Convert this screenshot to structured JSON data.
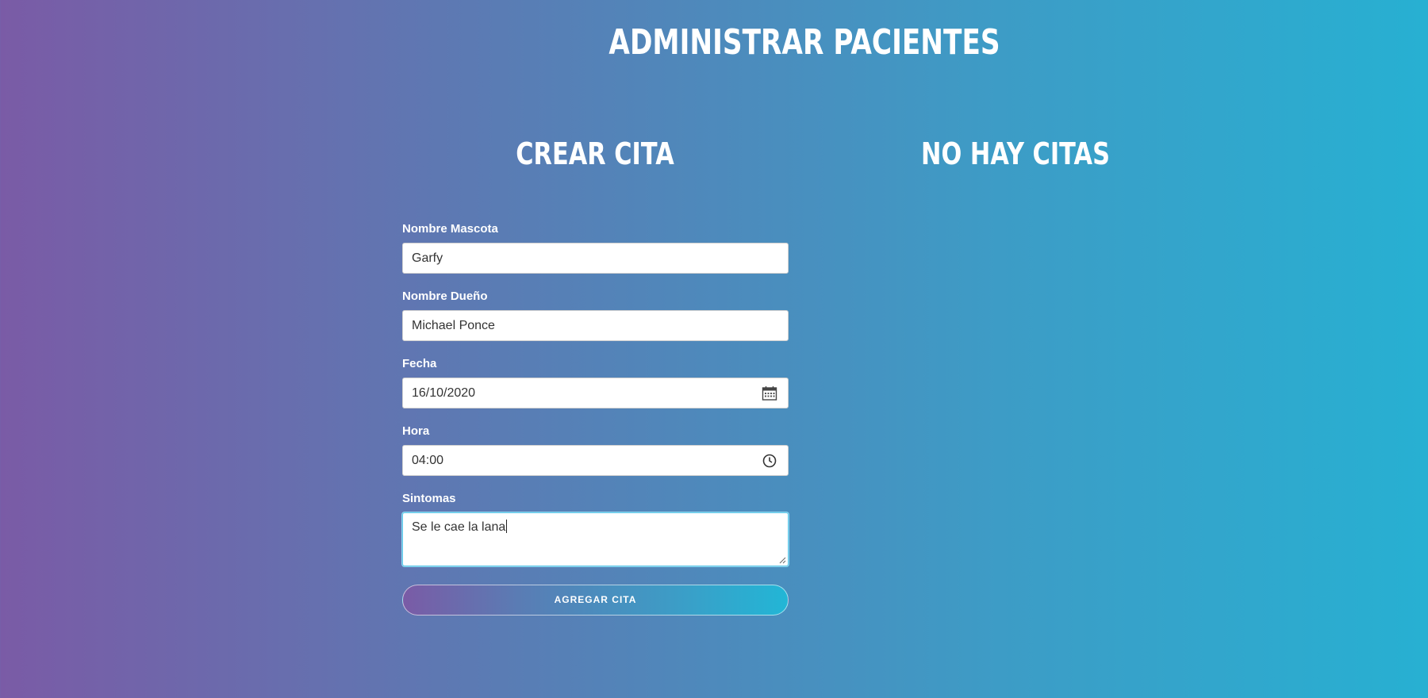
{
  "header": {
    "title": "Administrar Pacientes"
  },
  "sections": {
    "create_title": "Crear Cita",
    "list_title": "No hay citas"
  },
  "form": {
    "pet_name": {
      "label": "Nombre Mascota",
      "value": "Garfy"
    },
    "owner_name": {
      "label": "Nombre Dueño",
      "value": "Michael Ponce"
    },
    "date": {
      "label": "Fecha",
      "value": "16/10/2020",
      "icon": "calendar-icon"
    },
    "time": {
      "label": "Hora",
      "value": "04:00",
      "icon": "clock-icon"
    },
    "symptoms": {
      "label": "Sintomas",
      "value": "Se le cae la lana"
    },
    "submit_label": "Agregar Cita"
  },
  "colors": {
    "gradient_start": "#7a5ba6",
    "gradient_end": "#27b0d2",
    "focus_border": "#5fc6e8"
  }
}
